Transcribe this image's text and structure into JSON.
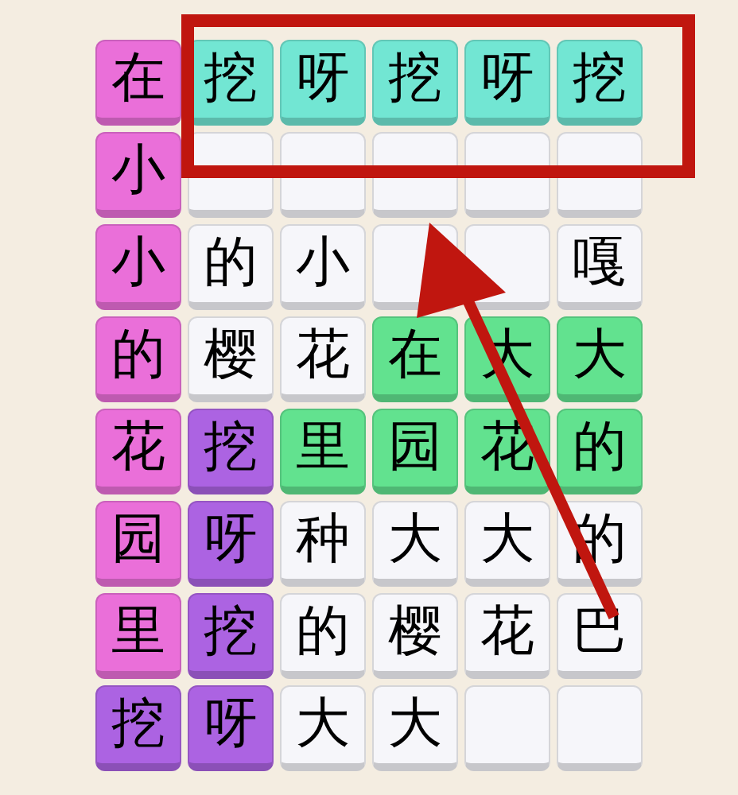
{
  "grid": {
    "rows": [
      {
        "tiles": [
          {
            "char": "在",
            "color": "#ea6fd9"
          },
          {
            "char": "挖",
            "color": "#72e6d3"
          },
          {
            "char": "呀",
            "color": "#72e6d3"
          },
          {
            "char": "挖",
            "color": "#72e6d3"
          },
          {
            "char": "呀",
            "color": "#72e6d3"
          },
          {
            "char": "挖",
            "color": "#72e6d3"
          }
        ]
      },
      {
        "tiles": [
          {
            "char": "小",
            "color": "#ea6fd9"
          },
          {
            "color": "#f6f6fa"
          },
          {
            "color": "#f6f6fa"
          },
          {
            "color": "#f6f6fa"
          },
          {
            "color": "#f6f6fa"
          },
          {
            "color": "#f6f6fa"
          }
        ]
      },
      {
        "tiles": [
          {
            "char": "小",
            "color": "#ea6fd9"
          },
          {
            "char": "的",
            "color": "#f6f6fa"
          },
          {
            "char": "小",
            "color": "#f6f6fa"
          },
          {
            "color": "#f6f6fa"
          },
          {
            "color": "#f6f6fa"
          },
          {
            "char": "嘎",
            "color": "#f6f6fa"
          }
        ]
      },
      {
        "tiles": [
          {
            "char": "的",
            "color": "#ea6fd9"
          },
          {
            "char": "樱",
            "color": "#f6f6fa"
          },
          {
            "char": "花",
            "color": "#f6f6fa"
          },
          {
            "char": "在",
            "color": "#62e28f"
          },
          {
            "char": "大",
            "color": "#62e28f"
          },
          {
            "char": "大",
            "color": "#62e28f"
          }
        ]
      },
      {
        "tiles": [
          {
            "char": "花",
            "color": "#ea6fd9"
          },
          {
            "char": "挖",
            "color": "#ac63e2"
          },
          {
            "char": "里",
            "color": "#62e28f"
          },
          {
            "char": "园",
            "color": "#62e28f"
          },
          {
            "char": "花",
            "color": "#62e28f"
          },
          {
            "char": "的",
            "color": "#62e28f"
          }
        ]
      },
      {
        "tiles": [
          {
            "char": "园",
            "color": "#ea6fd9"
          },
          {
            "char": "呀",
            "color": "#ac63e2"
          },
          {
            "char": "种",
            "color": "#f6f6fa"
          },
          {
            "char": "大",
            "color": "#f6f6fa"
          },
          {
            "char": "大",
            "color": "#f6f6fa"
          },
          {
            "char": "的",
            "color": "#f6f6fa"
          }
        ]
      },
      {
        "tiles": [
          {
            "char": "里",
            "color": "#ea6fd9"
          },
          {
            "char": "挖",
            "color": "#ac63e2"
          },
          {
            "char": "的",
            "color": "#f6f6fa"
          },
          {
            "char": "樱",
            "color": "#f6f6fa"
          },
          {
            "char": "花",
            "color": "#f6f6fa"
          },
          {
            "char": "巴",
            "color": "#f6f6fa"
          }
        ]
      },
      {
        "tiles": [
          {
            "char": "挖",
            "color": "#ac63e2"
          },
          {
            "char": "呀",
            "color": "#ac63e2"
          },
          {
            "char": "大",
            "color": "#f6f6fa"
          },
          {
            "char": "大",
            "color": "#f6f6fa"
          },
          {
            "color": "#f6f6fa"
          },
          {
            "color": "#f6f6fa"
          }
        ]
      }
    ]
  },
  "annotations": {
    "highlight_box": true,
    "arrow": true
  }
}
